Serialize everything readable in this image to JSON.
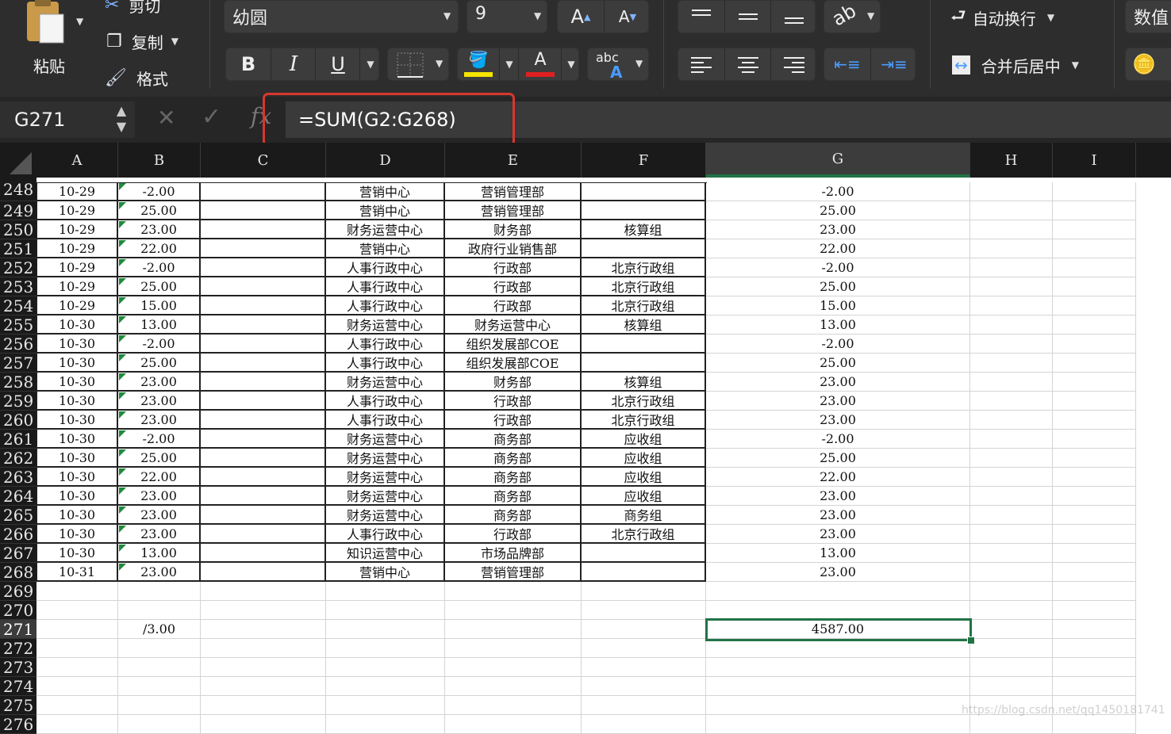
{
  "ribbon": {
    "paste_label": "粘贴",
    "cut_label": "剪切",
    "copy_label": "复制",
    "format_label": "格式",
    "font_name": "幼圆",
    "font_size": "9",
    "bold_label": "B",
    "italic_label": "I",
    "underline_label": "U",
    "increase_font_label": "A",
    "decrease_font_label": "A",
    "font_color_label": "A",
    "abc_label": "abc",
    "abc_sub_label": "A",
    "wrap_text_label": "自动换行",
    "merge_center_label": "合并后居中",
    "number_label": "数值",
    "colors": {
      "highlight": "#f5e400",
      "font_color": "#e02020",
      "accent": "#217346",
      "callout": "#d9372e"
    }
  },
  "formula_bar": {
    "cell_ref": "G271",
    "fx_label": "fx",
    "formula": "=SUM(G2:G268)"
  },
  "columns": [
    "A",
    "B",
    "C",
    "D",
    "E",
    "F",
    "G",
    "H",
    "I"
  ],
  "selected_column": "G",
  "rows": [
    {
      "num": "248",
      "a": "10-29",
      "b": "-2.00",
      "d": "营销中心",
      "e": "营销管理部",
      "f": "",
      "g": "-2.00"
    },
    {
      "num": "249",
      "a": "10-29",
      "b": "25.00",
      "d": "营销中心",
      "e": "营销管理部",
      "f": "",
      "g": "25.00"
    },
    {
      "num": "250",
      "a": "10-29",
      "b": "23.00",
      "d": "财务运营中心",
      "e": "财务部",
      "f": "核算组",
      "g": "23.00"
    },
    {
      "num": "251",
      "a": "10-29",
      "b": "22.00",
      "d": "营销中心",
      "e": "政府行业销售部",
      "f": "",
      "g": "22.00"
    },
    {
      "num": "252",
      "a": "10-29",
      "b": "-2.00",
      "d": "人事行政中心",
      "e": "行政部",
      "f": "北京行政组",
      "g": "-2.00"
    },
    {
      "num": "253",
      "a": "10-29",
      "b": "25.00",
      "d": "人事行政中心",
      "e": "行政部",
      "f": "北京行政组",
      "g": "25.00"
    },
    {
      "num": "254",
      "a": "10-29",
      "b": "15.00",
      "d": "人事行政中心",
      "e": "行政部",
      "f": "北京行政组",
      "g": "15.00"
    },
    {
      "num": "255",
      "a": "10-30",
      "b": "13.00",
      "d": "财务运营中心",
      "e": "财务运营中心",
      "f": "核算组",
      "g": "13.00"
    },
    {
      "num": "256",
      "a": "10-30",
      "b": "-2.00",
      "d": "人事行政中心",
      "e": "组织发展部COE",
      "f": "",
      "g": "-2.00"
    },
    {
      "num": "257",
      "a": "10-30",
      "b": "25.00",
      "d": "人事行政中心",
      "e": "组织发展部COE",
      "f": "",
      "g": "25.00"
    },
    {
      "num": "258",
      "a": "10-30",
      "b": "23.00",
      "d": "财务运营中心",
      "e": "财务部",
      "f": "核算组",
      "g": "23.00"
    },
    {
      "num": "259",
      "a": "10-30",
      "b": "23.00",
      "d": "人事行政中心",
      "e": "行政部",
      "f": "北京行政组",
      "g": "23.00"
    },
    {
      "num": "260",
      "a": "10-30",
      "b": "23.00",
      "d": "人事行政中心",
      "e": "行政部",
      "f": "北京行政组",
      "g": "23.00"
    },
    {
      "num": "261",
      "a": "10-30",
      "b": "-2.00",
      "d": "财务运营中心",
      "e": "商务部",
      "f": "应收组",
      "g": "-2.00"
    },
    {
      "num": "262",
      "a": "10-30",
      "b": "25.00",
      "d": "财务运营中心",
      "e": "商务部",
      "f": "应收组",
      "g": "25.00"
    },
    {
      "num": "263",
      "a": "10-30",
      "b": "22.00",
      "d": "财务运营中心",
      "e": "商务部",
      "f": "应收组",
      "g": "22.00"
    },
    {
      "num": "264",
      "a": "10-30",
      "b": "23.00",
      "d": "财务运营中心",
      "e": "商务部",
      "f": "应收组",
      "g": "23.00"
    },
    {
      "num": "265",
      "a": "10-30",
      "b": "23.00",
      "d": "财务运营中心",
      "e": "商务部",
      "f": "商务组",
      "g": "23.00"
    },
    {
      "num": "266",
      "a": "10-30",
      "b": "23.00",
      "d": "人事行政中心",
      "e": "行政部",
      "f": "北京行政组",
      "g": "23.00"
    },
    {
      "num": "267",
      "a": "10-30",
      "b": "13.00",
      "d": "知识运营中心",
      "e": "市场品牌部",
      "f": "",
      "g": "13.00"
    },
    {
      "num": "268",
      "a": "10-31",
      "b": "23.00",
      "d": "营销中心",
      "e": "营销管理部",
      "f": "",
      "g": "23.00"
    },
    {
      "num": "269",
      "a": "",
      "b": "",
      "d": "",
      "e": "",
      "f": "",
      "g": ""
    },
    {
      "num": "270",
      "a": "",
      "b": "",
      "d": "",
      "e": "",
      "f": "",
      "g": ""
    },
    {
      "num": "271",
      "a": "",
      "b": "/3.00",
      "d": "",
      "e": "",
      "f": "",
      "g": "4587.00"
    },
    {
      "num": "272",
      "a": "",
      "b": "",
      "d": "",
      "e": "",
      "f": "",
      "g": ""
    },
    {
      "num": "273",
      "a": "",
      "b": "",
      "d": "",
      "e": "",
      "f": "",
      "g": ""
    },
    {
      "num": "274",
      "a": "",
      "b": "",
      "d": "",
      "e": "",
      "f": "",
      "g": ""
    },
    {
      "num": "275",
      "a": "",
      "b": "",
      "d": "",
      "e": "",
      "f": "",
      "g": ""
    },
    {
      "num": "276",
      "a": "",
      "b": "",
      "d": "",
      "e": "",
      "f": "",
      "g": ""
    }
  ],
  "active_cell": "G271",
  "watermark": "https://blog.csdn.net/qq1450181741"
}
